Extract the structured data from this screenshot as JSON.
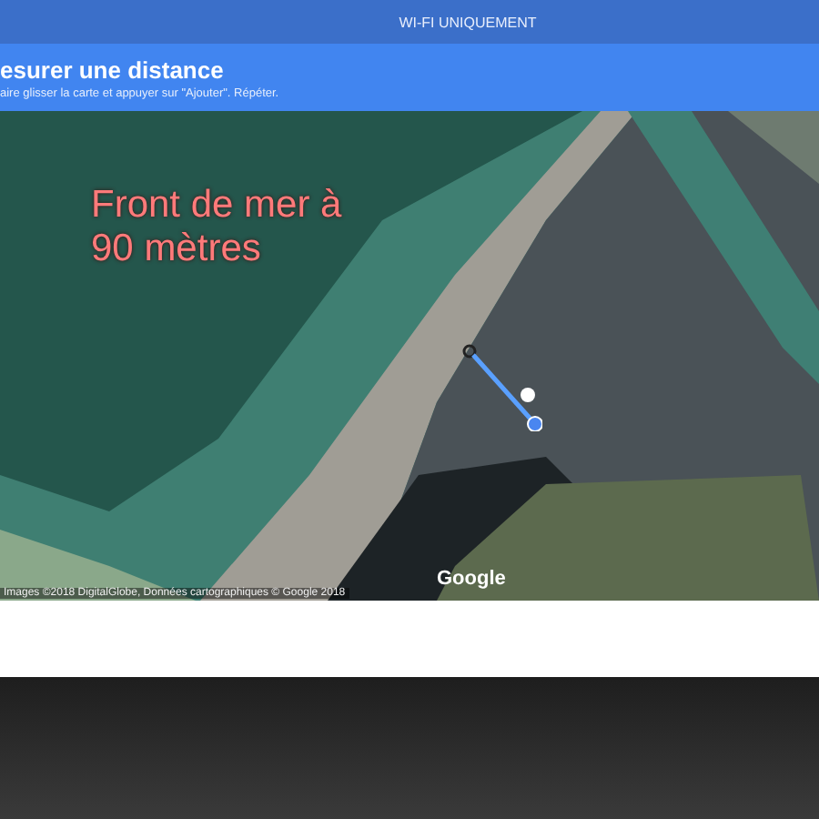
{
  "status_bar": {
    "text": "WI-FI UNIQUEMENT"
  },
  "header": {
    "title": "esurer une distance",
    "subtitle": "aire glisser la carte et appuyer sur \"Ajouter\". Répéter."
  },
  "map": {
    "annotation": "Front de mer à 90 mètres",
    "logo": "Google",
    "attribution": "Images ©2018 DigitalGlobe, Données cartographiques © Google 2018"
  }
}
